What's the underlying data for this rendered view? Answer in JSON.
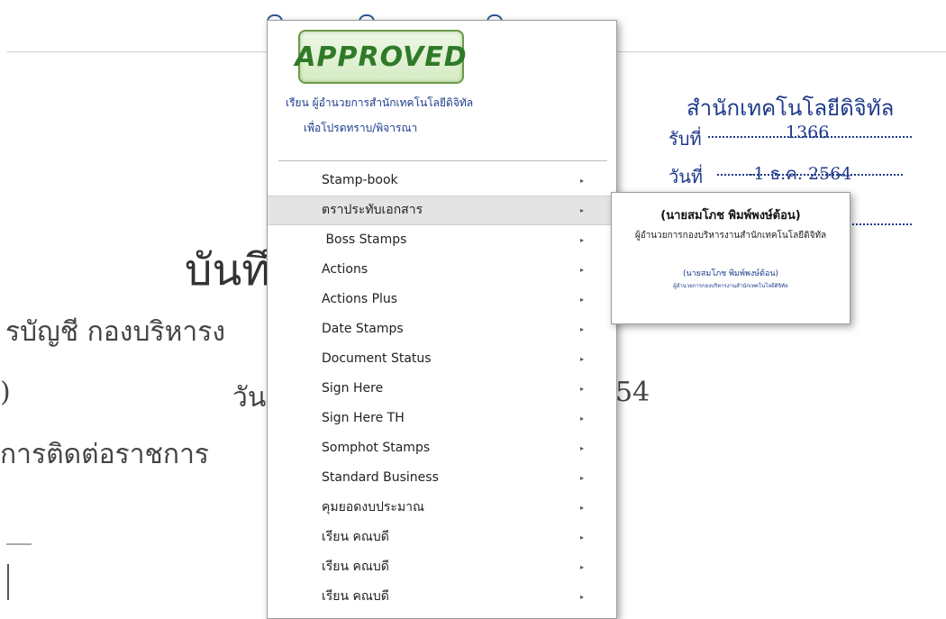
{
  "document": {
    "dept_title": "สำนักเทคโนโลยีดิจิทัล",
    "received_no_label": "รับที่",
    "received_no_value": "1366",
    "date_label": "วันที่",
    "date_value": "-1 ธ.ค. 2564",
    "big_title_fragment": "บันทึ",
    "line_1": "รบัญชี  กองบริหารง",
    "line_2_left": ")",
    "line_2_mid": "วัน",
    "line_2_right": "54",
    "line_3": "การติดต่อราชการ"
  },
  "stamp_panel": {
    "approved_text": "APPROVED",
    "line1": "เรียน  ผู้อำนวยการสำนักเทคโนโลยีดิจิทัล",
    "line2": "เพื่อโปรดทราบ/พิจารณา"
  },
  "menu": {
    "items": [
      {
        "label": "Stamp-book",
        "highlighted": false
      },
      {
        "label": "ตราประทับเอกสาร",
        "highlighted": true
      },
      {
        "label": " Boss Stamps",
        "highlighted": false
      },
      {
        "label": "Actions",
        "highlighted": false
      },
      {
        "label": "Actions Plus",
        "highlighted": false
      },
      {
        "label": "Date Stamps",
        "highlighted": false
      },
      {
        "label": "Document Status",
        "highlighted": false
      },
      {
        "label": "Sign Here",
        "highlighted": false
      },
      {
        "label": "Sign Here TH",
        "highlighted": false
      },
      {
        "label": "Somphot Stamps",
        "highlighted": false
      },
      {
        "label": "Standard Business",
        "highlighted": false
      },
      {
        "label": "คุมยอดงบประมาณ",
        "highlighted": false
      },
      {
        "label": "เรียน คณบดี",
        "highlighted": false
      },
      {
        "label": "เรียน คณบดี",
        "highlighted": false
      },
      {
        "label": "เรียน คณบดี",
        "highlighted": false
      }
    ],
    "arrow_glyph": "▸"
  },
  "submenu": {
    "name_large": "(นายสมโภช พิมพ์พงษ์ต้อน)",
    "position_large": "ผู้อำนวยการกองบริหารงานสำนักเทคโนโลยีดิจิทัล",
    "name_small": "(นายสมโภช พิมพ์พงษ์ต้อน)",
    "position_small": "ผู้อำนวยการกองบริหารงานสำนักเทคโนโลยีดิจิทัล"
  },
  "colors": {
    "stamp_green": "#2f7a28",
    "stamp_blue": "#1b3c8c",
    "doc_blue": "#1e3a8a",
    "highlight": "#e4e4e4"
  }
}
